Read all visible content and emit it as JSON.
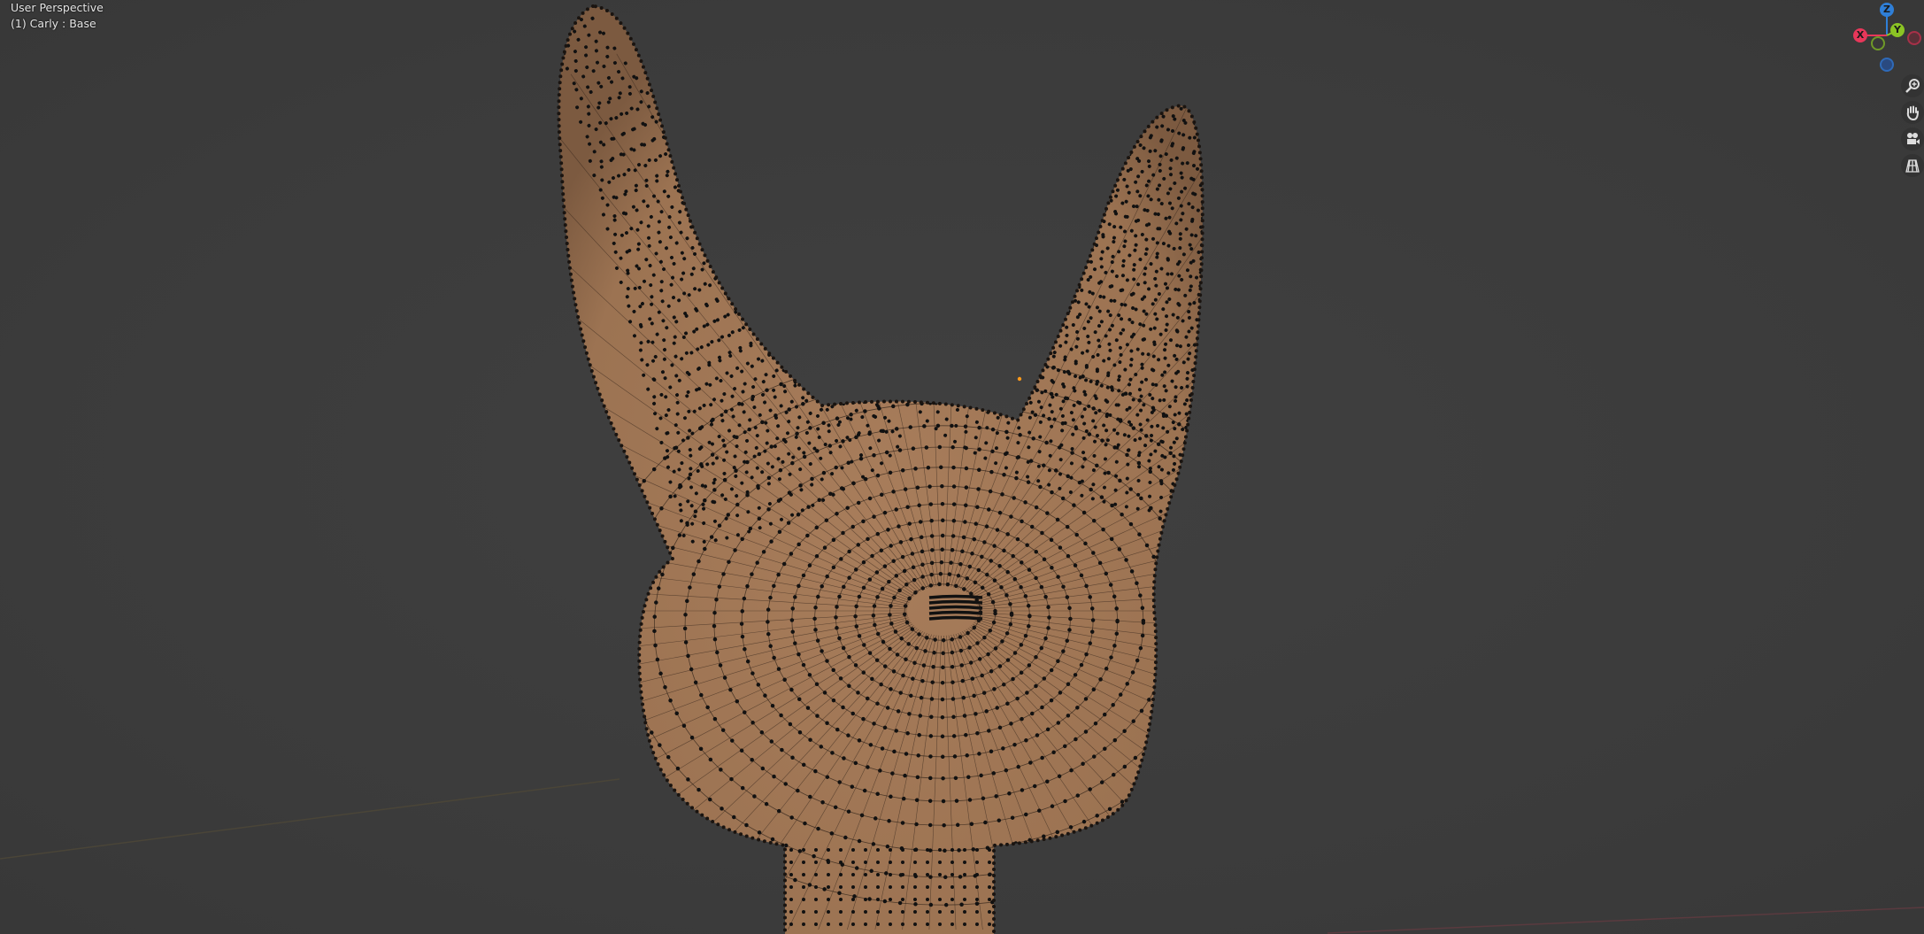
{
  "viewport": {
    "view_name": "User Perspective",
    "object_info": "(1) Carly : Base"
  },
  "gizmo": {
    "x_label": "X",
    "y_label": "Y",
    "z_label": "Z",
    "colors": {
      "x": "#e8375a",
      "y": "#8bc424",
      "z": "#2f7fd8"
    }
  },
  "nav_buttons": [
    {
      "name": "zoom",
      "icon": "zoom-icon"
    },
    {
      "name": "pan",
      "icon": "hand-icon"
    },
    {
      "name": "camera",
      "icon": "camera-icon"
    },
    {
      "name": "ortho",
      "icon": "grid-icon"
    }
  ],
  "mesh_color": "#a47a58"
}
